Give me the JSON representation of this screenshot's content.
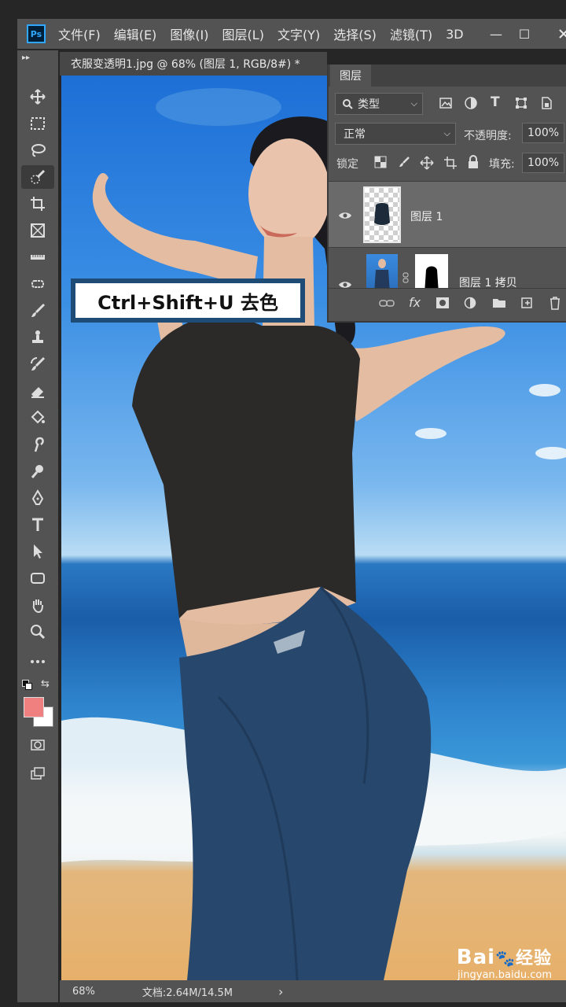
{
  "app": {
    "logo": "Ps"
  },
  "menu": [
    "文件(F)",
    "编辑(E)",
    "图像(I)",
    "图层(L)",
    "文字(Y)",
    "选择(S)",
    "滤镜(T)",
    "3D"
  ],
  "window_controls": {
    "minimize": "—",
    "restore": "☐"
  },
  "document": {
    "tab_title": "衣服变透明1.jpg @ 68% (图层 1, RGB/8#) *"
  },
  "status": {
    "zoom": "68%",
    "doc_info": "文档:2.64M/14.5M",
    "arrow": "›"
  },
  "caption": {
    "text": "Ctrl+Shift+U 去色"
  },
  "layers_panel": {
    "tab": "图层",
    "filter_label": "类型",
    "blend_mode": "正常",
    "opacity_label": "不透明度:",
    "opacity_value": "100%",
    "lock_label": "锁定",
    "fill_label": "填充:",
    "fill_value": "100%",
    "layers": [
      {
        "name": "图层 1"
      },
      {
        "name": "图层 1 拷贝"
      }
    ]
  },
  "watermark": {
    "brand": "Bai",
    "brand2": "经验",
    "url": "jingyan.baidu.com"
  },
  "colors": {
    "foreground": "#f08080",
    "background": "#ffffff",
    "accent": "#31a8ff"
  }
}
